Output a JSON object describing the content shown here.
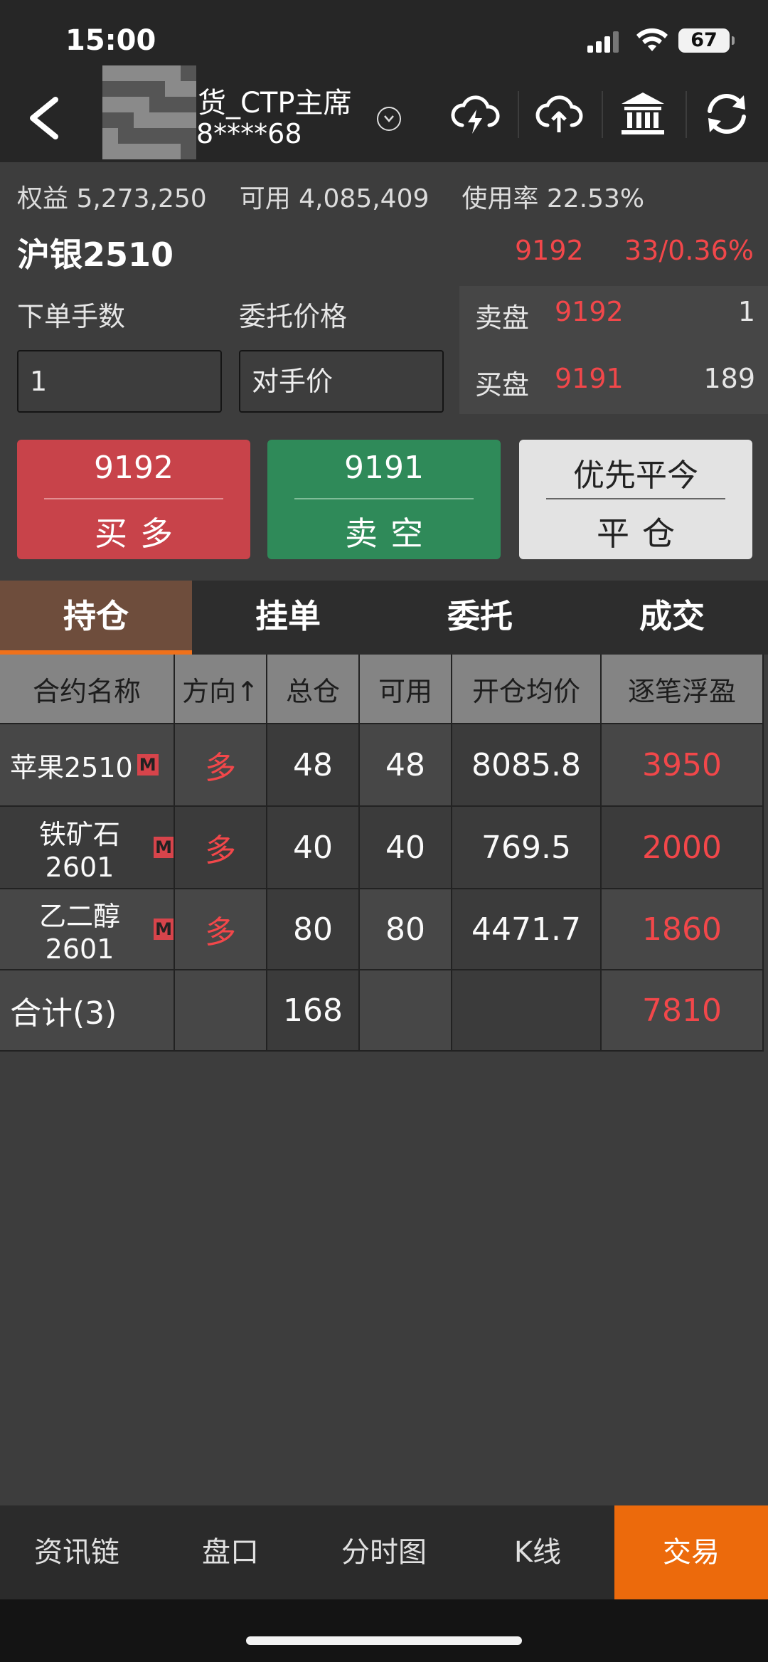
{
  "status_bar": {
    "time": "15:00",
    "battery": "67"
  },
  "header": {
    "account_title": "货_CTP主席",
    "account_number": "8****68",
    "icons": [
      "back-icon",
      "cloud-lightning-icon",
      "cloud-upload-icon",
      "bank-icon",
      "refresh-icon"
    ]
  },
  "summary": {
    "equity_label": "权益",
    "equity": "5,273,250",
    "available_label": "可用",
    "available": "4,085,409",
    "usage_label": "使用率",
    "usage": "22.53%"
  },
  "contract": {
    "name": "沪银2510",
    "last_price": "9192",
    "change": "33/0.36%"
  },
  "order": {
    "lots_label": "下单手数",
    "lots_value": "1",
    "price_label": "委托价格",
    "price_value": "对手价"
  },
  "order_book": {
    "ask_label": "卖盘",
    "ask_price": "9192",
    "ask_qty": "1",
    "bid_label": "买盘",
    "bid_price": "9191",
    "bid_qty": "189"
  },
  "trade_buttons": {
    "buy_price": "9192",
    "buy_label": "买多",
    "sell_price": "9191",
    "sell_label": "卖空",
    "close_mode": "优先平今",
    "close_label": "平仓"
  },
  "tabs": [
    "持仓",
    "挂单",
    "委托",
    "成交"
  ],
  "positions": {
    "headers": [
      "合约名称",
      "方向↑",
      "总仓",
      "可用",
      "开仓均价",
      "逐笔浮盈"
    ],
    "rows": [
      {
        "name": "苹果2510",
        "tag": "M",
        "direction": "多",
        "total": "48",
        "available": "48",
        "avg_price": "8085.8",
        "pnl": "3950"
      },
      {
        "name": "铁矿石2601",
        "tag": "M",
        "direction": "多",
        "total": "40",
        "available": "40",
        "avg_price": "769.5",
        "pnl": "2000"
      },
      {
        "name": "乙二醇2601",
        "tag": "M",
        "direction": "多",
        "total": "80",
        "available": "80",
        "avg_price": "4471.7",
        "pnl": "1860"
      }
    ],
    "total_row": {
      "label": "合计(3)",
      "total": "168",
      "pnl": "7810"
    }
  },
  "bottom_nav": [
    "资讯链",
    "盘口",
    "分时图",
    "K线",
    "交易"
  ],
  "colors": {
    "up_red": "#f2474a",
    "buy_bg": "#c8434a",
    "sell_bg": "#2f8a59",
    "active_orange": "#ec6a0c",
    "tab_active": "#6e4d3c"
  }
}
